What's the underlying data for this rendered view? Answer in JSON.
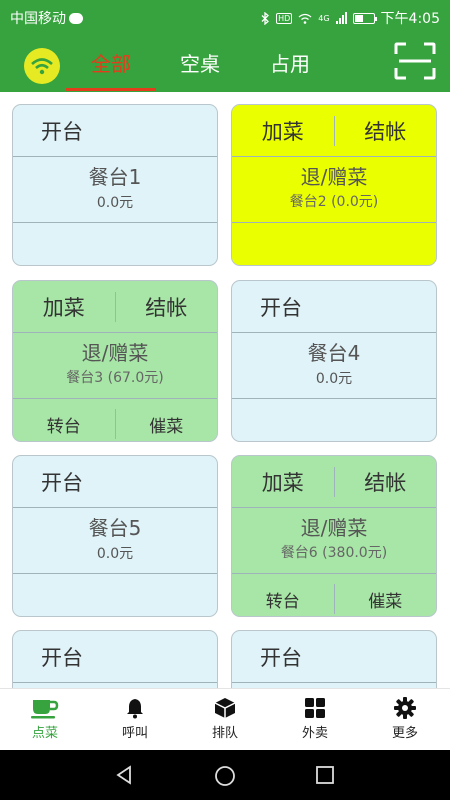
{
  "status_bar": {
    "carrier": "中国移动",
    "network": "4G",
    "time": "下午4:05"
  },
  "header": {
    "tabs": [
      {
        "label": "全部",
        "active": true
      },
      {
        "label": "空桌",
        "active": false
      },
      {
        "label": "占用",
        "active": false
      }
    ],
    "accent_color": "#36a33e",
    "active_tab_color": "#e33d1c"
  },
  "tables": [
    {
      "status": "empty",
      "color": "#e0f3f8",
      "open_label": "开台",
      "name": "餐台1",
      "amount": "0.0元"
    },
    {
      "status": "occupied",
      "color": "#eaff00",
      "add_label": "加菜",
      "checkout_label": "结帐",
      "return_label": "退/赠菜",
      "summary": "餐台2 (0.0元)"
    },
    {
      "status": "occupied",
      "color": "#a7e6a6",
      "add_label": "加菜",
      "checkout_label": "结帐",
      "return_label": "退/赠菜",
      "summary": "餐台3 (67.0元)",
      "transfer_label": "转台",
      "urge_label": "催菜"
    },
    {
      "status": "empty",
      "color": "#e0f3f8",
      "open_label": "开台",
      "name": "餐台4",
      "amount": "0.0元"
    },
    {
      "status": "empty",
      "color": "#e0f3f8",
      "open_label": "开台",
      "name": "餐台5",
      "amount": "0.0元"
    },
    {
      "status": "occupied",
      "color": "#a7e6a6",
      "add_label": "加菜",
      "checkout_label": "结帐",
      "return_label": "退/赠菜",
      "summary": "餐台6 (380.0元)",
      "transfer_label": "转台",
      "urge_label": "催菜"
    },
    {
      "status": "empty",
      "color": "#e0f3f8",
      "open_label": "开台"
    },
    {
      "status": "empty",
      "color": "#e0f3f8",
      "open_label": "开台"
    }
  ],
  "bottom_nav": [
    {
      "label": "点菜",
      "icon": "coffee-cup-icon",
      "active": true
    },
    {
      "label": "呼叫",
      "icon": "bell-icon",
      "active": false
    },
    {
      "label": "排队",
      "icon": "box-icon",
      "active": false
    },
    {
      "label": "外卖",
      "icon": "grid-icon",
      "active": false
    },
    {
      "label": "更多",
      "icon": "gear-icon",
      "active": false
    }
  ]
}
